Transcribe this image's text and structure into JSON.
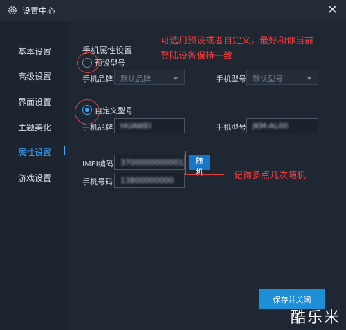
{
  "window": {
    "title": "设置中心",
    "close_glyph": "✕"
  },
  "sidebar": {
    "items": [
      {
        "label": "基本设置",
        "active": false
      },
      {
        "label": "高级设置",
        "active": false
      },
      {
        "label": "界面设置",
        "active": false
      },
      {
        "label": "主题美化",
        "active": false
      },
      {
        "label": "属性设置",
        "active": true
      },
      {
        "label": "游戏设置",
        "active": false
      }
    ]
  },
  "section": {
    "title": "手机属性设置"
  },
  "preset": {
    "radio_label": "预设型号",
    "selected": false,
    "brand_label": "手机品牌",
    "brand_placeholder": "默认品牌",
    "model_label": "手机型号",
    "model_placeholder": "默认型号"
  },
  "custom": {
    "radio_label": "自定义型号",
    "selected": true,
    "brand_label": "手机品牌",
    "brand_value": "HUAWEI",
    "model_label": "手机型号",
    "model_value": "JKM-AL00"
  },
  "imei": {
    "label": "IMEI编码",
    "value": "3700000000001238"
  },
  "phone": {
    "label": "手机号码",
    "value": "13800000000"
  },
  "random_button": {
    "label": "随机"
  },
  "save_button": {
    "label": "保存并关闭"
  },
  "annotations": {
    "top_note_line1": "可选用预设或者自定义，最好和你当前",
    "top_note_line2": "登陆设备保持一致",
    "random_note": "记得多点几次随机",
    "color": "#ff3b3b"
  },
  "watermark": "酷乐米",
  "colors": {
    "accent": "#3ea9ff",
    "button": "#1677c9",
    "save": "#1c8fd6",
    "background": "#1f2733"
  }
}
